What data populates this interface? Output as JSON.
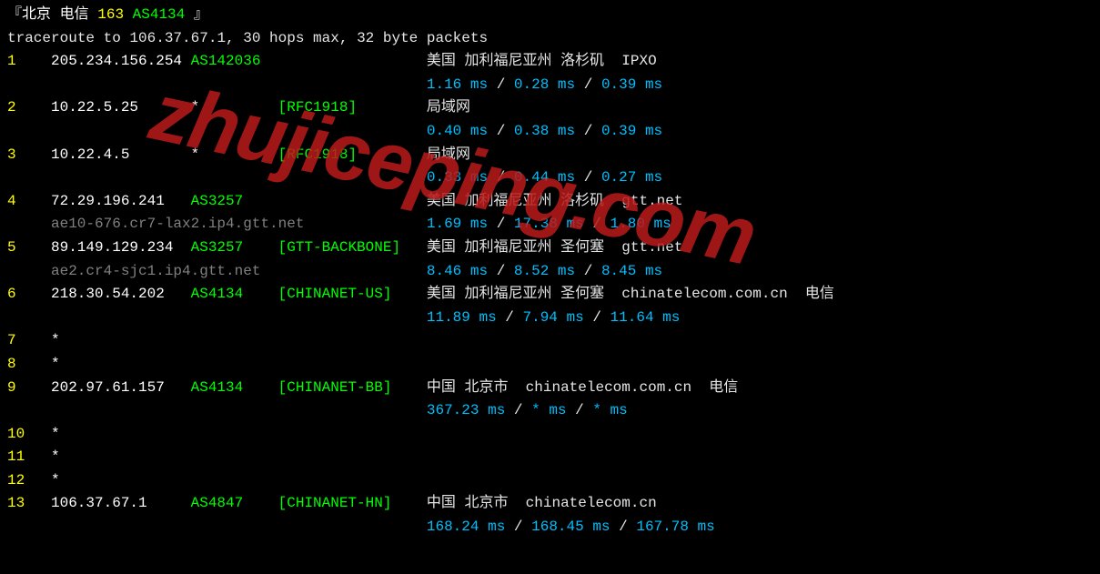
{
  "header": {
    "left_bracket": "『",
    "loc": "北京 电信 ",
    "asn_short": "163 ",
    "asn_full": "AS4134",
    "right_bracket": " 』"
  },
  "cmd": "traceroute to 106.37.67.1, 30 hops max, 32 byte packets",
  "hops": [
    {
      "n": "1",
      "ip": "205.234.156.254",
      "asn": "AS142036",
      "tag": "",
      "loc": "美国 加利福尼亚州 洛杉矶  IPXO",
      "rtt": [
        "1.16 ms",
        "0.28 ms",
        "0.39 ms"
      ],
      "reverse": ""
    },
    {
      "n": "2",
      "ip": "10.22.5.25",
      "asn": "*",
      "tag": "[RFC1918]",
      "loc": "局域网",
      "rtt": [
        "0.40 ms",
        "0.38 ms",
        "0.39 ms"
      ],
      "reverse": ""
    },
    {
      "n": "3",
      "ip": "10.22.4.5",
      "asn": "*",
      "tag": "[RFC1918]",
      "loc": "局域网",
      "rtt": [
        "0.33 ms",
        "0.44 ms",
        "0.27 ms"
      ],
      "reverse": ""
    },
    {
      "n": "4",
      "ip": "72.29.196.241",
      "asn": "AS3257",
      "tag": "",
      "loc": "美国 加利福尼亚州 洛杉矶  gtt.net",
      "rtt": [
        "1.69 ms",
        "17.38 ms",
        "1.80 ms"
      ],
      "reverse": "ae10-676.cr7-lax2.ip4.gtt.net"
    },
    {
      "n": "5",
      "ip": "89.149.129.234",
      "asn": "AS3257",
      "tag": "[GTT-BACKBONE]",
      "loc": "美国 加利福尼亚州 圣何塞  gtt.net",
      "rtt": [
        "8.46 ms",
        "8.52 ms",
        "8.45 ms"
      ],
      "reverse": "ae2.cr4-sjc1.ip4.gtt.net"
    },
    {
      "n": "6",
      "ip": "218.30.54.202",
      "asn": "AS4134",
      "tag": "[CHINANET-US]",
      "loc": "美国 加利福尼亚州 圣何塞  chinatelecom.com.cn  电信",
      "rtt": [
        "11.89 ms",
        "7.94 ms",
        "11.64 ms"
      ],
      "reverse": ""
    },
    {
      "n": "7",
      "star": true
    },
    {
      "n": "8",
      "star": true
    },
    {
      "n": "9",
      "ip": "202.97.61.157",
      "asn": "AS4134",
      "tag": "[CHINANET-BB]",
      "loc": "中国 北京市  chinatelecom.com.cn  电信",
      "rtt": [
        "367.23 ms",
        "* ms",
        "* ms"
      ],
      "reverse": ""
    },
    {
      "n": "10",
      "star": true
    },
    {
      "n": "11",
      "star": true
    },
    {
      "n": "12",
      "star": true
    },
    {
      "n": "13",
      "ip": "106.37.67.1",
      "asn": "AS4847",
      "tag": "[CHINANET-HN]",
      "loc": "中国 北京市  chinatelecom.cn",
      "rtt": [
        "168.24 ms",
        "168.45 ms",
        "167.78 ms"
      ],
      "reverse": ""
    }
  ],
  "rtt_separator": " / ",
  "watermark": "zhujiceping.com"
}
